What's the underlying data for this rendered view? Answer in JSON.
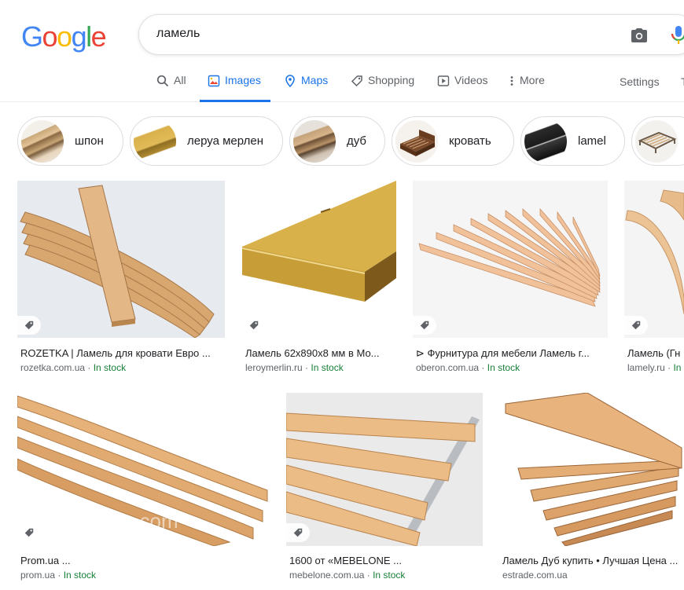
{
  "logo": {
    "letters": [
      {
        "ch": "G",
        "color": "#4285F4"
      },
      {
        "ch": "o",
        "color": "#EA4335"
      },
      {
        "ch": "o",
        "color": "#FBBC05"
      },
      {
        "ch": "g",
        "color": "#4285F4"
      },
      {
        "ch": "l",
        "color": "#34A853"
      },
      {
        "ch": "e",
        "color": "#EA4335"
      }
    ]
  },
  "search": {
    "query": "ламель"
  },
  "tabs": [
    {
      "label": "All",
      "icon": "search-icon"
    },
    {
      "label": "Images",
      "icon": "image-icon",
      "active": true
    },
    {
      "label": "Maps",
      "icon": "map-pin-icon"
    },
    {
      "label": "Shopping",
      "icon": "tag-icon"
    },
    {
      "label": "Videos",
      "icon": "play-icon"
    },
    {
      "label": "More",
      "icon": "more-vert-icon"
    }
  ],
  "settings_label": "Settings",
  "tools_label": "T",
  "chips": [
    {
      "label": "шпон"
    },
    {
      "label": "леруа мерлен"
    },
    {
      "label": "дуб"
    },
    {
      "label": "кровать"
    },
    {
      "label": "lamel"
    },
    {
      "label": ""
    }
  ],
  "results": [
    {
      "caption": "ROZETKA | Ламель для кровати Евро ...",
      "domain": "rozetka.com.ua",
      "stock": "In stock"
    },
    {
      "caption": "Ламель 62х890х8 мм в Мо...",
      "domain": "leroymerlin.ru",
      "stock": "In stock"
    },
    {
      "caption": "⊳ Фурнитура для мебели Ламель г...",
      "domain": "oberon.com.ua",
      "stock": "In stock"
    },
    {
      "caption": "Ламель (Гн",
      "domain": "lamely.ru",
      "stock": "In"
    },
    {
      "caption": "Prom.ua ...",
      "domain": "prom.ua",
      "stock": "In stock"
    },
    {
      "caption": "1600 от «MEBELONE ...",
      "domain": "mebelone.com.ua",
      "stock": "In stock"
    },
    {
      "caption": "Ламель Дуб купить • Лучшая Цена ...",
      "domain": "estrade.com.ua",
      "stock": ""
    }
  ],
  "separator": " · ",
  "watermark": "sharm-im.com",
  "colors": {
    "accent": "#1a73e8",
    "stock_green": "#188038"
  }
}
